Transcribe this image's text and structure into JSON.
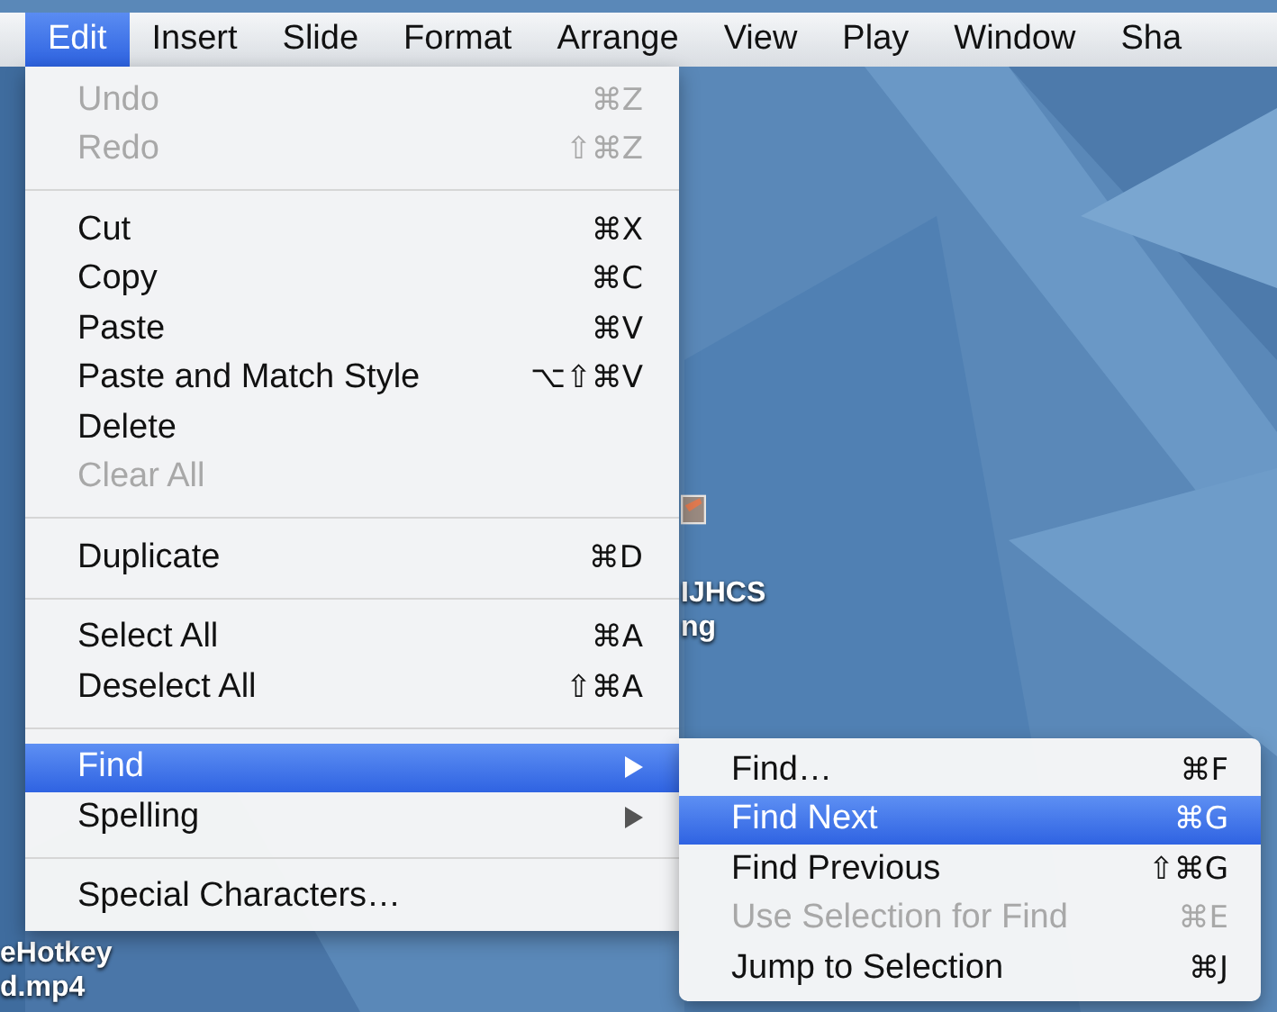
{
  "menu_bar": [
    {
      "label": "Edit",
      "selected": true
    },
    {
      "label": "Insert",
      "selected": false
    },
    {
      "label": "Slide",
      "selected": false
    },
    {
      "label": "Format",
      "selected": false
    },
    {
      "label": "Arrange",
      "selected": false
    },
    {
      "label": "View",
      "selected": false
    },
    {
      "label": "Play",
      "selected": false
    },
    {
      "label": "Window",
      "selected": false
    },
    {
      "label": "Sha",
      "selected": false
    }
  ],
  "desktop_icons": [
    {
      "kind": "picture",
      "lines": [
        "IJHCS",
        "ng"
      ]
    },
    {
      "kind": "label",
      "lines": [
        "eHotkey",
        "d.mp4"
      ]
    }
  ],
  "edit_menu": {
    "items": [
      {
        "kind": "item",
        "label": "Undo",
        "shortcut": "⌘Z",
        "disabled": true,
        "selected": false
      },
      {
        "kind": "item",
        "label": "Redo",
        "shortcut": "⇧⌘Z",
        "disabled": true,
        "selected": false
      },
      {
        "kind": "separator"
      },
      {
        "kind": "item",
        "label": "Cut",
        "shortcut": "⌘X",
        "disabled": false,
        "selected": false
      },
      {
        "kind": "item",
        "label": "Copy",
        "shortcut": "⌘C",
        "disabled": false,
        "selected": false
      },
      {
        "kind": "item",
        "label": "Paste",
        "shortcut": "⌘V",
        "disabled": false,
        "selected": false
      },
      {
        "kind": "item",
        "label": "Paste and Match Style",
        "shortcut": "⌥⇧⌘V",
        "disabled": false,
        "selected": false
      },
      {
        "kind": "item",
        "label": "Delete",
        "disabled": false,
        "selected": false
      },
      {
        "kind": "item",
        "label": "Clear All",
        "disabled": true,
        "selected": false
      },
      {
        "kind": "separator"
      },
      {
        "kind": "item",
        "label": "Duplicate",
        "shortcut": "⌘D",
        "disabled": false,
        "selected": false
      },
      {
        "kind": "separator"
      },
      {
        "kind": "item",
        "label": "Select All",
        "shortcut": "⌘A",
        "disabled": false,
        "selected": false
      },
      {
        "kind": "item",
        "label": "Deselect All",
        "shortcut": "⇧⌘A",
        "disabled": false,
        "selected": false
      },
      {
        "kind": "separator"
      },
      {
        "kind": "submenu",
        "label": "Find",
        "disabled": false,
        "selected": true
      },
      {
        "kind": "submenu",
        "label": "Spelling",
        "disabled": false,
        "selected": false
      },
      {
        "kind": "separator"
      },
      {
        "kind": "item",
        "label": "Special Characters…",
        "disabled": false,
        "selected": false
      }
    ]
  },
  "find_submenu": {
    "items": [
      {
        "kind": "item",
        "label": "Find…",
        "shortcut": "⌘F",
        "disabled": false,
        "selected": false
      },
      {
        "kind": "item",
        "label": "Find Next",
        "shortcut": "⌘G",
        "disabled": false,
        "selected": true
      },
      {
        "kind": "item",
        "label": "Find Previous",
        "shortcut": "⇧⌘G",
        "disabled": false,
        "selected": false
      },
      {
        "kind": "item",
        "label": "Use Selection for Find",
        "shortcut": "⌘E",
        "disabled": true,
        "selected": false
      },
      {
        "kind": "item",
        "label": "Jump to Selection",
        "shortcut": "⌘J",
        "disabled": false,
        "selected": false
      }
    ]
  }
}
